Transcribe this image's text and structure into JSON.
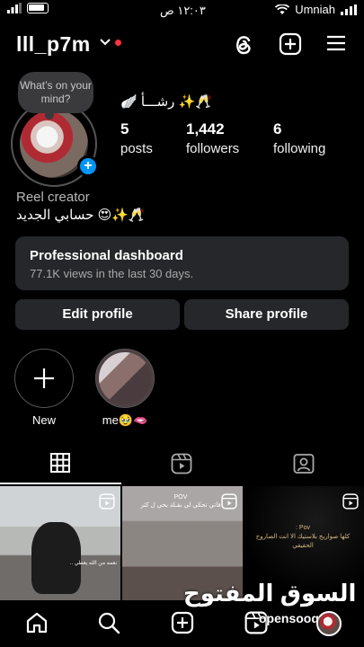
{
  "status_bar": {
    "time": "١٢:٠٣ ص",
    "carrier": "Umniah"
  },
  "header": {
    "username": "lll_p7m",
    "icons": [
      "chevron-down-icon",
      "threads-icon",
      "create-plus-icon",
      "menu-hamburger-icon"
    ]
  },
  "profile": {
    "note_bubble": "What’s on your mind?",
    "display_name": "🥂✨ رشـــأ 🪽",
    "stats": [
      {
        "value": "5",
        "label": "posts"
      },
      {
        "value": "1,442",
        "label": "followers"
      },
      {
        "value": "6",
        "label": "following"
      }
    ],
    "category": "Reel creator",
    "bio": "حسابي الجديد 😍✨🥂"
  },
  "dashboard": {
    "title": "Professional dashboard",
    "subtitle": "77.1K views in the last 30 days."
  },
  "actions": {
    "edit_profile": "Edit profile",
    "share_profile": "Share profile"
  },
  "highlights": [
    {
      "label": "New"
    },
    {
      "label": "me🥹🫦"
    }
  ],
  "tabs": [
    "grid-icon",
    "reels-icon",
    "tagged-icon"
  ],
  "grid_captions": {
    "post1": "نعمه من الله يعطي ..",
    "post2_title": "POV",
    "post2": "فاتي تحكي لي بقـلة بحي ل كثر",
    "post3_title": "Pov :",
    "post3": "كلها صواريخ بلاستيك الا انت الصاروخ الحقيقي"
  },
  "watermark": {
    "arabic": "السوق المفتوح",
    "latin": "opensooq"
  },
  "bottom_nav": [
    "home-icon",
    "search-icon",
    "create-icon",
    "reels-icon",
    "profile-avatar"
  ],
  "colors": {
    "background": "#000000",
    "card": "#26272b",
    "accent_blue": "#0095f6",
    "notification_red": "#ff3040"
  }
}
